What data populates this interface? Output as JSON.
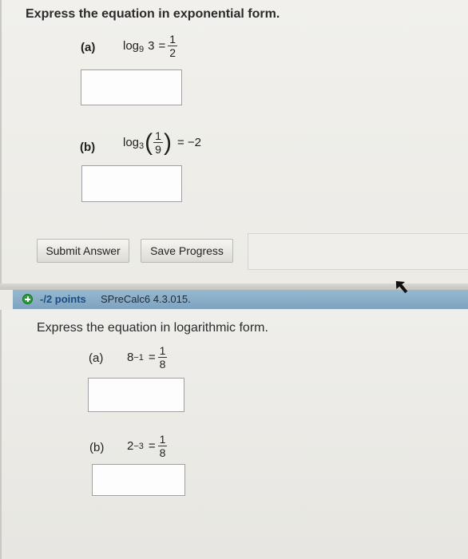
{
  "question1": {
    "title": "Express the equation in exponential form.",
    "part_a": {
      "label": "(a)",
      "log": "log",
      "base": "9",
      "arg": "3",
      "equals": "=",
      "num": "1",
      "den": "2"
    },
    "part_b": {
      "label": "(b)",
      "log": "log",
      "base": "3",
      "num": "1",
      "den": "9",
      "equals": "= −2"
    }
  },
  "buttons": {
    "submit": "Submit Answer",
    "save": "Save Progress"
  },
  "question2_header": {
    "points": "-/2 points",
    "course": "SPreCalc6 4.3.015."
  },
  "question2": {
    "title": "Express the equation in logarithmic form.",
    "part_a": {
      "label": "(a)",
      "base": "8",
      "exp": "−1",
      "equals": "=",
      "num": "1",
      "den": "8"
    },
    "part_b": {
      "label": "(b)",
      "base": "2",
      "exp": "−3",
      "equals": "=",
      "num": "1",
      "den": "8"
    }
  },
  "colors": {
    "header_bar": "#7ea3bf",
    "points_text": "#1d4d80",
    "plus_icon": "#2f9a3b"
  }
}
